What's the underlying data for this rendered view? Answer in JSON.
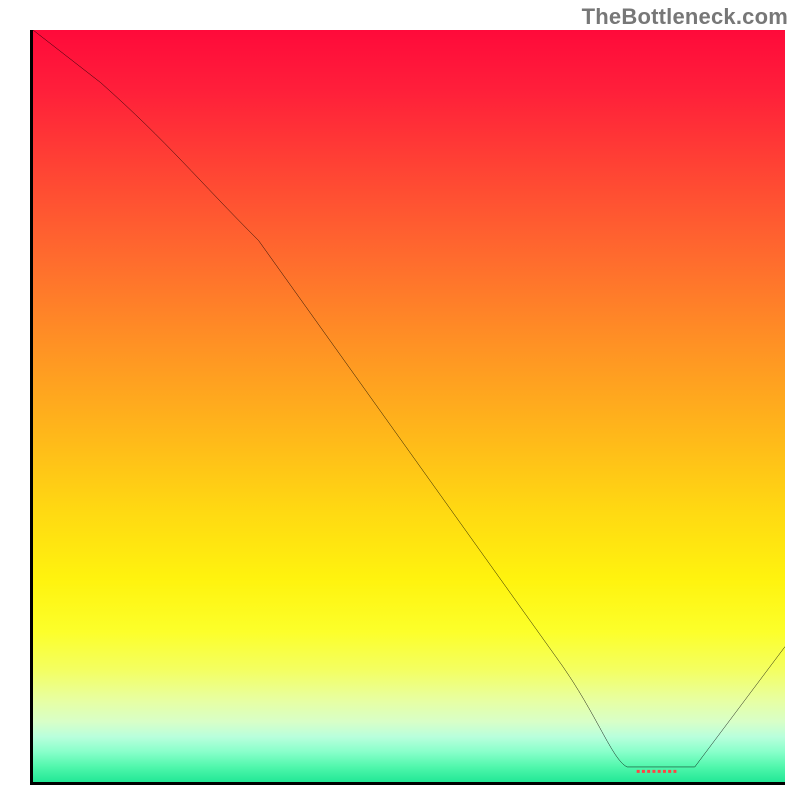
{
  "attribution": "TheBottleneck.com",
  "marker_glyph": "▪▪▪▪▪▪▪▪",
  "chart_data": {
    "type": "line",
    "title": "",
    "xlabel": "",
    "ylabel": "",
    "xlim": [
      0,
      100
    ],
    "ylim": [
      0,
      100
    ],
    "series": [
      {
        "name": "curve",
        "x": [
          0,
          9,
          22,
          30,
          50,
          70,
          79,
          88,
          100
        ],
        "y": [
          100,
          93,
          80,
          72,
          44,
          16,
          2,
          2,
          18
        ]
      }
    ],
    "gradient_stops": [
      {
        "pos": 0,
        "color": "#ff0a3a"
      },
      {
        "pos": 8,
        "color": "#ff1f3a"
      },
      {
        "pos": 18,
        "color": "#ff4234"
      },
      {
        "pos": 30,
        "color": "#ff6a2e"
      },
      {
        "pos": 42,
        "color": "#ff9224"
      },
      {
        "pos": 54,
        "color": "#ffb81a"
      },
      {
        "pos": 64,
        "color": "#ffd912"
      },
      {
        "pos": 73,
        "color": "#fff30e"
      },
      {
        "pos": 80,
        "color": "#fcff2a"
      },
      {
        "pos": 85,
        "color": "#f4ff60"
      },
      {
        "pos": 89,
        "color": "#e8ffa0"
      },
      {
        "pos": 92,
        "color": "#d8ffc8"
      },
      {
        "pos": 94,
        "color": "#b8ffdc"
      },
      {
        "pos": 96,
        "color": "#88ffca"
      },
      {
        "pos": 98,
        "color": "#50f7ac"
      },
      {
        "pos": 100,
        "color": "#22e896"
      }
    ],
    "marker": {
      "x": 83,
      "y": 1.5
    }
  }
}
